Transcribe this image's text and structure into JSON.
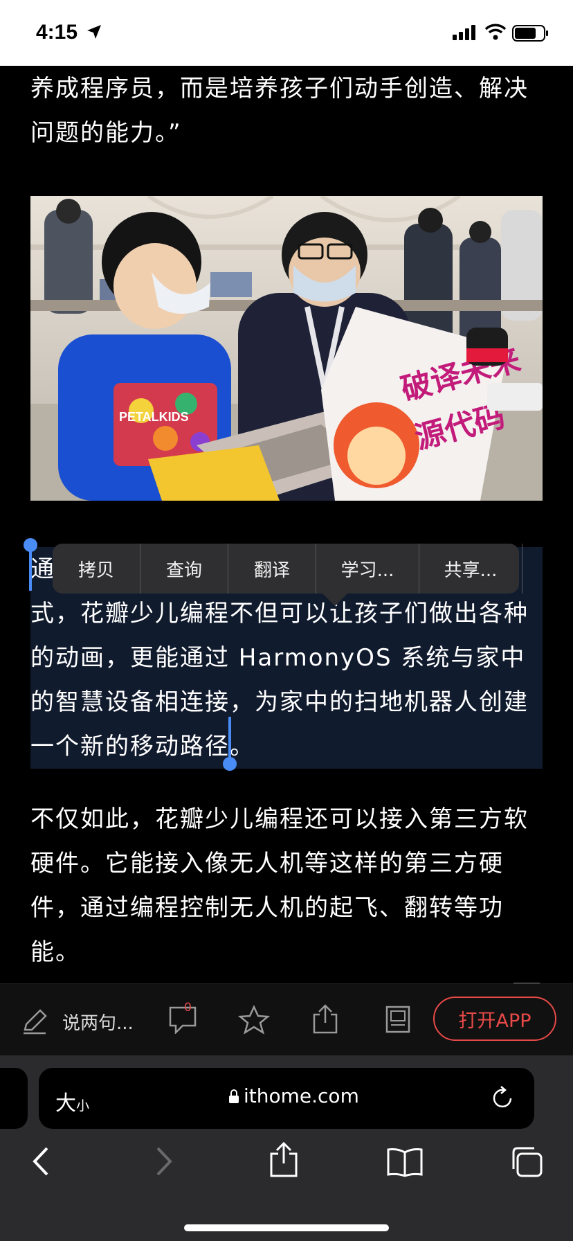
{
  "status_bar": {
    "time": "4:15"
  },
  "article": {
    "paragraph_intro": "养成程序员，而是培养孩子们动手创造、解决问题的能力。”",
    "paragraph_selected": "通过可视化图形编程、积木式控件等多种方式，花瓣少儿编程不但可以让孩子们做出各种的动画，更能通过 HarmonyOS 系统与家中的智慧设备相连接，为家中的扫地机器人创建一个新的移动路径。",
    "paragraph_next": "不仅如此，花瓣少儿编程还可以接入第三方软硬件。它能接入像无人机等这样的第三方硬件，通过编程控制无人机的起飞、翻转等功能。",
    "photo": {
      "sign_line_1": "破译未来",
      "sign_line_2": "源代码",
      "shirt_text": "PETALKIDS"
    }
  },
  "context_menu": {
    "items": [
      "拷贝",
      "查询",
      "翻译",
      "学习...",
      "共享..."
    ]
  },
  "site_toolbar": {
    "comment_placeholder": "说两句...",
    "comment_count": "0",
    "open_app_label": "打开APP",
    "accent_color": "#e84a48"
  },
  "safari": {
    "text_size_big": "大",
    "text_size_small": "小",
    "host": "ithome.com"
  },
  "colors": {
    "selection": "#111b2e",
    "selection_handle": "#4a8cf6"
  }
}
